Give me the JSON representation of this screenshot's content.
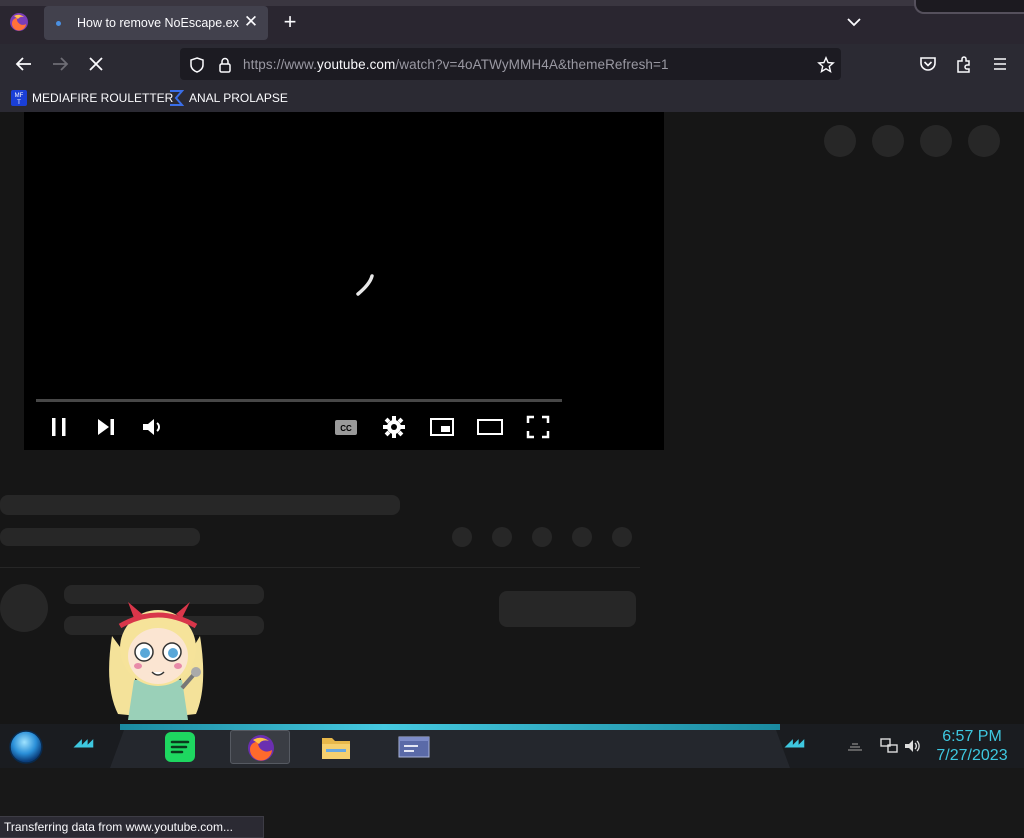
{
  "browser": {
    "tab": {
      "title": "How to remove NoEscape.exe ("
    },
    "address_bar": {
      "url_prefix": "https://www.",
      "url_domain": "youtube.com",
      "url_rest": "/watch?v=4oATWyMMH4A&themeRefresh=1"
    },
    "bookmarks": [
      {
        "label": "MEDIAFIRE ROULETTER",
        "icon": "mediafire-icon"
      },
      {
        "label": "ANAL PROLAPSE",
        "icon": "sigma-icon"
      }
    ],
    "status_text": "Transferring data from www.youtube.com..."
  },
  "player": {
    "state": "loading",
    "controls": [
      "pause",
      "next",
      "volume",
      "captions",
      "settings",
      "miniplayer",
      "theater",
      "fullscreen"
    ]
  },
  "taskbar": {
    "apps": [
      "spotify-icon",
      "firefox-icon",
      "file-explorer-icon",
      "window-icon"
    ],
    "clock": {
      "time": "6:57 PM",
      "date": "7/27/2023"
    },
    "accent_color": "#3ec8e0"
  }
}
